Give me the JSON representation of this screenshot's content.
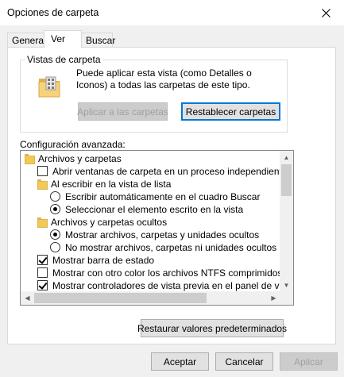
{
  "window": {
    "title": "Opciones de carpeta"
  },
  "tabs": [
    {
      "label": "General"
    },
    {
      "label": "Ver"
    },
    {
      "label": "Buscar"
    }
  ],
  "folder_views": {
    "group_title": "Vistas de carpeta",
    "description": "Puede aplicar esta vista (como Detalles o Iconos) a todas las carpetas de este tipo.",
    "apply_label": "Aplicar a las carpetas",
    "reset_label": "Restablecer carpetas"
  },
  "advanced": {
    "label": "Configuración avanzada:",
    "items": [
      {
        "kind": "folder",
        "level": 0,
        "label": "Archivos y carpetas"
      },
      {
        "kind": "checkbox",
        "level": 1,
        "checked": false,
        "label": "Abrir ventanas de carpeta  en un proceso independiente"
      },
      {
        "kind": "folder",
        "level": 1,
        "label": "Al escribir en la vista de lista"
      },
      {
        "kind": "radio",
        "level": 2,
        "checked": false,
        "label": "Escribir automáticamente en el cuadro Buscar"
      },
      {
        "kind": "radio",
        "level": 2,
        "checked": true,
        "label": "Seleccionar el elemento escrito en la vista"
      },
      {
        "kind": "folder",
        "level": 1,
        "label": "Archivos y carpetas ocultos"
      },
      {
        "kind": "radio",
        "level": 2,
        "checked": true,
        "label": "Mostrar archivos, carpetas y unidades ocultos"
      },
      {
        "kind": "radio",
        "level": 2,
        "checked": false,
        "label": "No mostrar archivos, carpetas ni unidades ocultos"
      },
      {
        "kind": "checkbox",
        "level": 1,
        "checked": true,
        "label": "Mostrar barra de estado"
      },
      {
        "kind": "checkbox",
        "level": 1,
        "checked": false,
        "label": "Mostrar con otro color los archivos NTFS comprimidos o c"
      },
      {
        "kind": "checkbox",
        "level": 1,
        "checked": true,
        "label": "Mostrar controladores de vista previa en el panel de vista"
      }
    ]
  },
  "restore_label": "Restaurar valores predeterminados",
  "footer": {
    "accept_label": "Aceptar",
    "cancel_label": "Cancelar",
    "apply_label": "Aplicar"
  },
  "icons": {
    "close": "close-icon",
    "folder_view": "folder-view-icon",
    "folder": "folder-icon"
  }
}
